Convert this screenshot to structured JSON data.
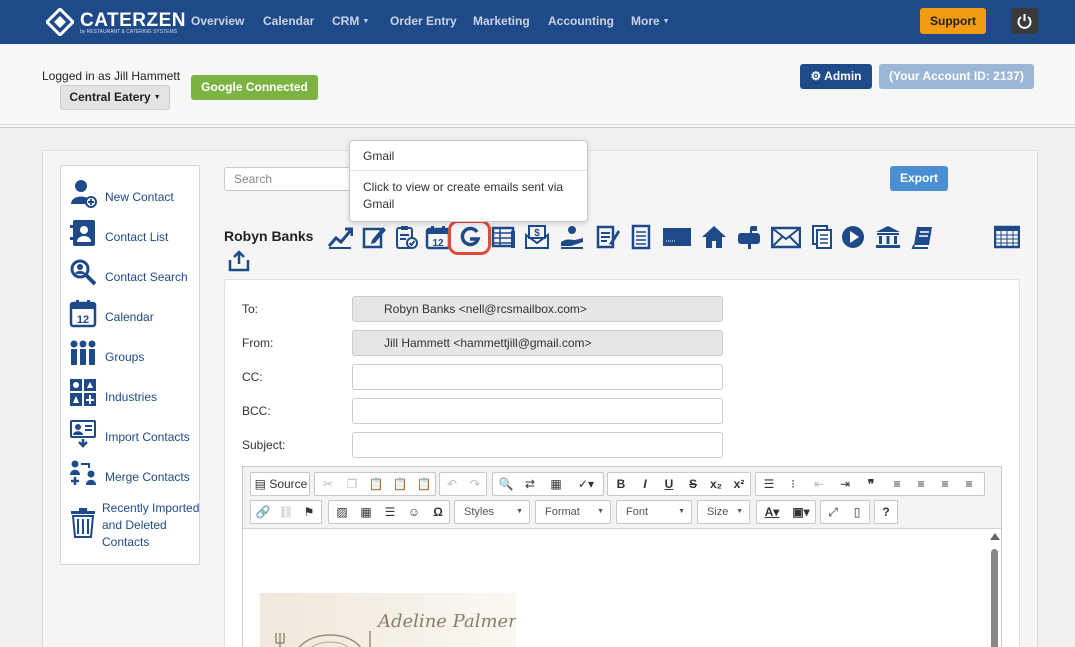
{
  "nav": {
    "logo_text": "CATERZEN",
    "logo_sub": "by RESTAURANT & CATERING SYSTEMS",
    "items": [
      {
        "label": "Overview",
        "dropdown": false
      },
      {
        "label": "Calendar",
        "dropdown": false
      },
      {
        "label": "CRM",
        "dropdown": true
      },
      {
        "label": "Order Entry",
        "dropdown": false
      },
      {
        "label": "Marketing",
        "dropdown": false
      },
      {
        "label": "Accounting",
        "dropdown": false
      },
      {
        "label": "More",
        "dropdown": true
      }
    ],
    "support_label": "Support",
    "power_icon": "power-icon"
  },
  "header": {
    "logged_in": "Logged in as Jill Hammett",
    "company": "Central Eatery",
    "google": "Google Connected",
    "admin": "Admin",
    "account_id": "(Your Account ID: 2137)"
  },
  "sidebar": {
    "items": [
      {
        "label": "New Contact",
        "icon": "add-user-icon"
      },
      {
        "label": "Contact List",
        "icon": "address-book-icon"
      },
      {
        "label": "Contact Search",
        "icon": "search-icon"
      },
      {
        "label": "Calendar",
        "icon": "calendar-icon"
      },
      {
        "label": "Groups",
        "icon": "group-icon"
      },
      {
        "label": "Industries",
        "icon": "industries-icon"
      },
      {
        "label": "Import Contacts",
        "icon": "import-icon"
      },
      {
        "label": "Merge Contacts",
        "icon": "merge-icon"
      },
      {
        "label": "Recently Imported and Deleted Contacts",
        "icon": "trash-icon"
      }
    ]
  },
  "search": {
    "placeholder": "Search"
  },
  "export_label": "Export",
  "tooltip": {
    "title": "Gmail",
    "body": "Click to view or create emails sent via Gmail"
  },
  "contact": {
    "name": "Robyn Banks",
    "icons": [
      "chart-trend-icon",
      "edit-icon",
      "clipboard-check-icon",
      "calendar-12-icon",
      "gmail-icon",
      "ledger-icon",
      "invoice-icon",
      "hand-coin-icon",
      "notes-icon",
      "document-icon",
      "card-icon",
      "home-icon",
      "mailbox-icon",
      "envelope-icon",
      "files-icon",
      "play-icon",
      "bank-icon",
      "book-icon",
      "spreadsheet-icon"
    ]
  },
  "form": {
    "to_label": "To:",
    "to_value": "Robyn Banks <nell@rcsmailbox.com>",
    "from_label": "From:",
    "from_value": "Jill Hammett <hammettjill@gmail.com>",
    "cc_label": "CC:",
    "bcc_label": "BCC:",
    "subject_label": "Subject:"
  },
  "editor": {
    "source_label": "Source",
    "styles_label": "Styles",
    "format_label": "Format",
    "font_label": "Font",
    "size_label": "Size",
    "signature_text": "Adeline Palmer"
  },
  "colors": {
    "nav_bg": "#1f4a8a",
    "support": "#f39c12",
    "google": "#7cb342",
    "export": "#4a8fd3",
    "highlight_ring": "#e04a3a",
    "icon": "#1f4a8a"
  }
}
